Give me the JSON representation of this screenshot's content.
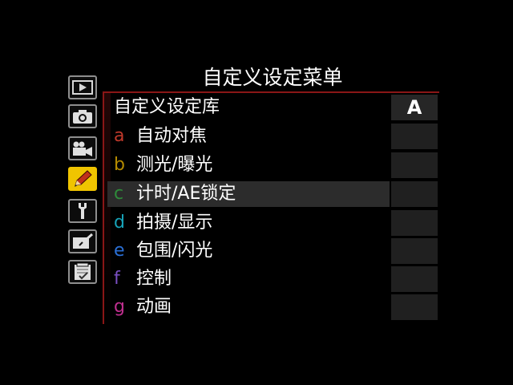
{
  "header": {
    "title": "自定义设定菜单"
  },
  "tabs": [
    {
      "name": "playback-icon",
      "active": false
    },
    {
      "name": "camera-icon",
      "active": false
    },
    {
      "name": "movie-camera-icon",
      "active": false
    },
    {
      "name": "pencil-icon",
      "active": true
    },
    {
      "name": "wrench-icon",
      "active": false
    },
    {
      "name": "retouch-icon",
      "active": false
    },
    {
      "name": "my-menu-icon",
      "active": false
    }
  ],
  "menu": {
    "bank": {
      "label": "自定义设定库",
      "value": "A"
    },
    "items": [
      {
        "letter": "a",
        "label": "自动对焦",
        "color": "#c0392b"
      },
      {
        "letter": "b",
        "label": "测光/曝光",
        "color": "#b58b00"
      },
      {
        "letter": "c",
        "label": "计时/AE锁定",
        "color": "#2e8b3a"
      },
      {
        "letter": "d",
        "label": "拍摄/显示",
        "color": "#17a3b8"
      },
      {
        "letter": "e",
        "label": "包围/闪光",
        "color": "#2a6fd6"
      },
      {
        "letter": "f",
        "label": "控制",
        "color": "#7a4fc2"
      },
      {
        "letter": "g",
        "label": "动画",
        "color": "#c02f8f"
      }
    ],
    "selected_index": 2
  },
  "colors": {
    "background": "#000000",
    "accent_tab": "#f0c400",
    "frame": "#8a1616"
  }
}
